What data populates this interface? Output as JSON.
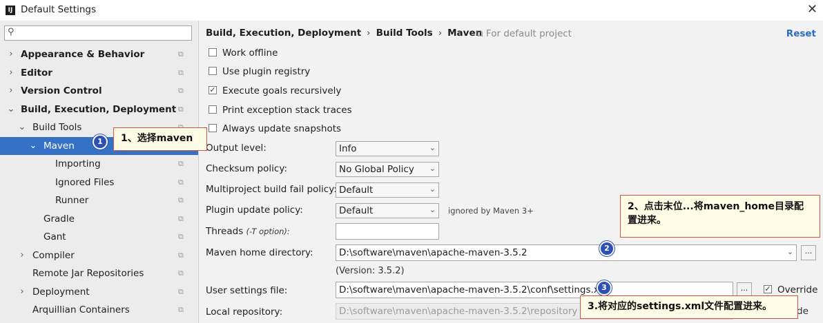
{
  "window": {
    "title": "Default Settings",
    "app_icon": "intellij-icon",
    "close_glyph": "✕"
  },
  "search": {
    "value": "",
    "placeholder": ""
  },
  "tree": [
    {
      "label": "Appearance & Behavior",
      "bold": true,
      "chevron": "›"
    },
    {
      "label": "Editor",
      "bold": true,
      "chevron": "›"
    },
    {
      "label": "Version Control",
      "bold": true,
      "chevron": "›"
    },
    {
      "label": "Build, Execution, Deployment",
      "bold": true,
      "chevron": "⌄"
    },
    {
      "label": "Build Tools",
      "bold": false,
      "chevron": "⌄"
    },
    {
      "label": "Maven",
      "bold": false,
      "chevron": "⌄",
      "selected": true
    },
    {
      "label": "Importing",
      "bold": false,
      "chevron": ""
    },
    {
      "label": "Ignored Files",
      "bold": false,
      "chevron": ""
    },
    {
      "label": "Runner",
      "bold": false,
      "chevron": ""
    },
    {
      "label": "Gradle",
      "bold": false,
      "chevron": ""
    },
    {
      "label": "Gant",
      "bold": false,
      "chevron": ""
    },
    {
      "label": "Compiler",
      "bold": false,
      "chevron": "›"
    },
    {
      "label": "Remote Jar Repositories",
      "bold": false,
      "chevron": ""
    },
    {
      "label": "Deployment",
      "bold": false,
      "chevron": "›"
    },
    {
      "label": "Arquillian Containers",
      "bold": false,
      "chevron": ""
    }
  ],
  "breadcrumb": {
    "items": [
      "Build, Execution, Deployment",
      "Build Tools",
      "Maven"
    ],
    "separator": "›",
    "note": "⧉ For default project",
    "reset": "Reset"
  },
  "checkboxes": [
    {
      "label": "Work offline",
      "checked": false
    },
    {
      "label": "Use plugin registry",
      "checked": false
    },
    {
      "label": "Execute goals recursively",
      "checked": true
    },
    {
      "label": "Print exception stack traces",
      "checked": false
    },
    {
      "label": "Always update snapshots",
      "checked": false
    }
  ],
  "form": {
    "output_level": {
      "label": "Output level:",
      "value": "Info"
    },
    "checksum_policy": {
      "label": "Checksum policy:",
      "value": "No Global Policy"
    },
    "multiproject_fail": {
      "label": "Multiproject build fail policy:",
      "value": "Default"
    },
    "plugin_update": {
      "label": "Plugin update policy:",
      "value": "Default",
      "note": "ignored by Maven 3+"
    },
    "threads": {
      "label": "Threads",
      "hint": "(-T option):",
      "value": ""
    },
    "maven_home": {
      "label": "Maven home directory:",
      "value": "D:\\software\\maven\\apache-maven-3.5.2",
      "version": "(Version: 3.5.2)"
    },
    "user_settings": {
      "label": "User settings file:",
      "value": "D:\\software\\maven\\apache-maven-3.5.2\\conf\\settings.xml",
      "override": "Override"
    },
    "local_repo": {
      "label": "Local repository:",
      "value": "D:\\software\\maven\\apache-maven-3.5.2\\repository",
      "override_tail": "de"
    },
    "browse_label": "..."
  },
  "annotations": {
    "a1": "1、选择maven",
    "a2": "2、点击末位...将maven_home目录配置进来。",
    "a3": "3.将对应的settings.xml文件配置进来。",
    "badge1": "1",
    "badge2": "2",
    "badge3": "3"
  },
  "colors": {
    "selection": "#3572c6",
    "link": "#2b6cc4",
    "badge": "#2c4fb8",
    "annotation_border": "#d4504a"
  }
}
